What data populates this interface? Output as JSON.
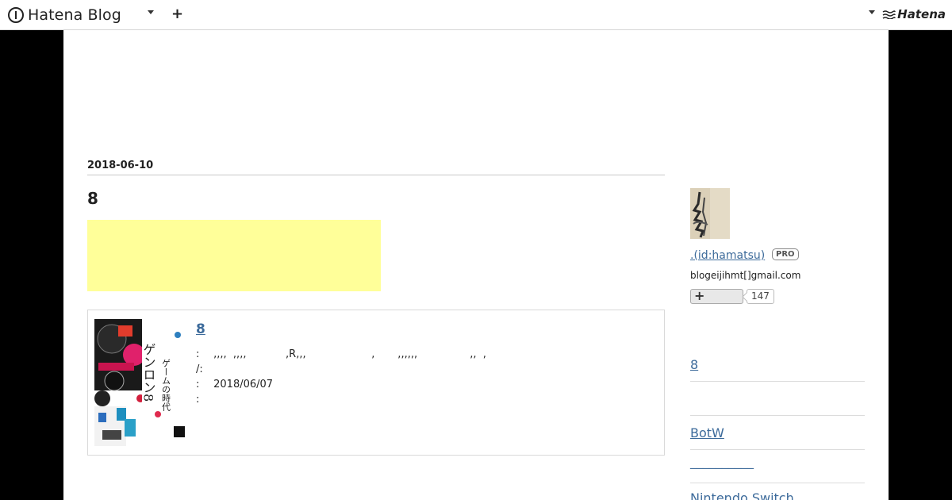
{
  "header": {
    "logo_text": "Hatena Blog",
    "brand_right": "Hatena"
  },
  "entry": {
    "date": "2018-06-10",
    "title": "8"
  },
  "book": {
    "title": "8 ",
    "meta": [
      {
        "key": ":",
        "value": " ,,,,  ,,,,            ,R,,,                    ,       ,,,,,,                ,,  ,"
      },
      {
        "key": "/:",
        "value": ""
      },
      {
        "key": ":",
        "value": " 2018/06/07"
      },
      {
        "key": ":",
        "value": ""
      }
    ]
  },
  "profile": {
    "user_link": ".(id:hamatsu)",
    "badge": "PRO",
    "email": "blogeijihmt[]gmail.com",
    "follow_count": "147"
  },
  "sidebar": {
    "links": [
      "8",
      "",
      "BotW",
      "__________",
      "Nintendo Switch"
    ]
  },
  "colors": {
    "link": "#3d6b9b",
    "ad_background": "#ffff99",
    "page_background": "#000000"
  }
}
